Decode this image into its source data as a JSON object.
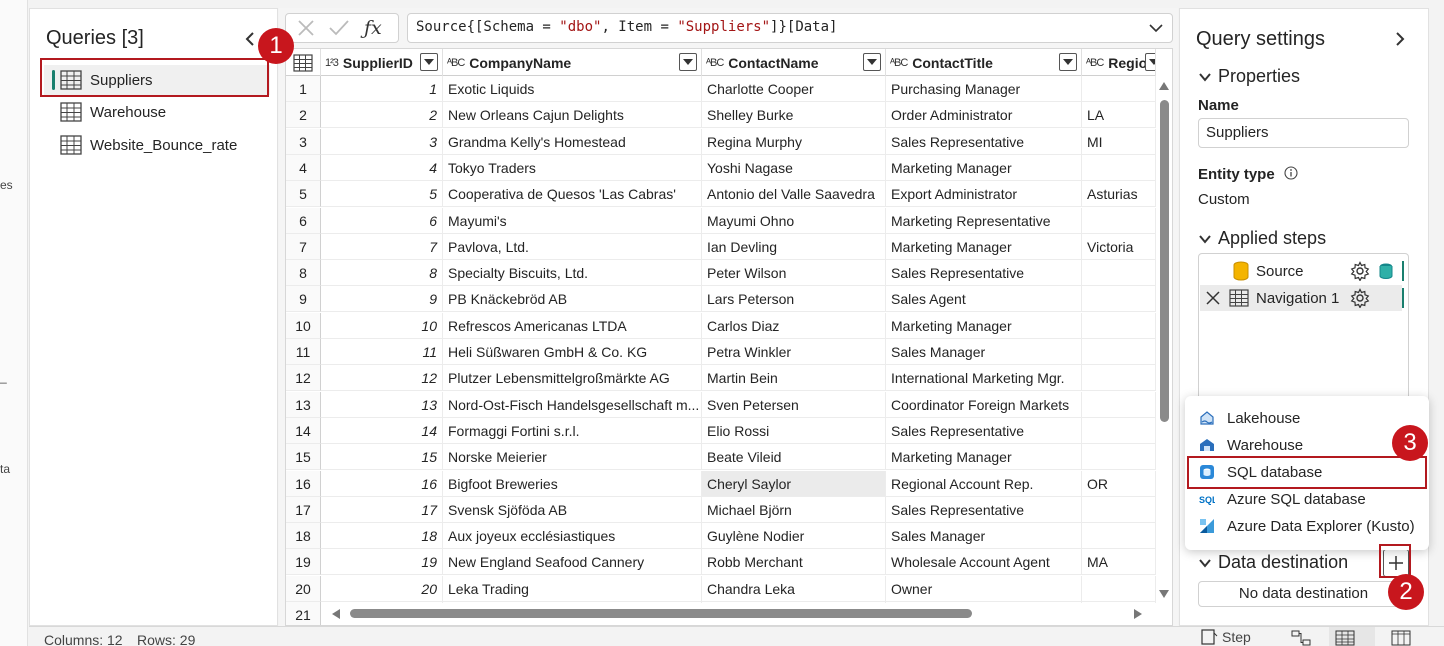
{
  "left_edge": {
    "fragments": [
      "es",
      "_",
      "ta"
    ]
  },
  "queries": {
    "title": "Queries [3]",
    "items": [
      {
        "label": "Suppliers"
      },
      {
        "label": "Warehouse"
      },
      {
        "label": "Website_Bounce_rate"
      }
    ]
  },
  "formula": {
    "prefix": "Source{[Schema = ",
    "str1": "\"dbo\"",
    "mid": ", Item = ",
    "str2": "\"Suppliers\"",
    "suffix": "]}[Data]"
  },
  "grid": {
    "type_icons": {
      "number": "1²3",
      "text": "ᴬBC"
    },
    "columns": [
      "SupplierID",
      "CompanyName",
      "ContactName",
      "ContactTitle",
      "Region"
    ],
    "rows": [
      [
        "1",
        "Exotic Liquids",
        "Charlotte Cooper",
        "Purchasing Manager",
        ""
      ],
      [
        "2",
        "New Orleans Cajun Delights",
        "Shelley Burke",
        "Order Administrator",
        "LA"
      ],
      [
        "3",
        "Grandma Kelly's Homestead",
        "Regina Murphy",
        "Sales Representative",
        "MI"
      ],
      [
        "4",
        "Tokyo Traders",
        "Yoshi Nagase",
        "Marketing Manager",
        ""
      ],
      [
        "5",
        "Cooperativa de Quesos 'Las Cabras'",
        "Antonio del Valle Saavedra",
        "Export Administrator",
        "Asturias"
      ],
      [
        "6",
        "Mayumi's",
        "Mayumi Ohno",
        "Marketing Representative",
        ""
      ],
      [
        "7",
        "Pavlova, Ltd.",
        "Ian Devling",
        "Marketing Manager",
        "Victoria"
      ],
      [
        "8",
        "Specialty Biscuits, Ltd.",
        "Peter Wilson",
        "Sales Representative",
        ""
      ],
      [
        "9",
        "PB Knäckebröd AB",
        "Lars Peterson",
        "Sales Agent",
        ""
      ],
      [
        "10",
        "Refrescos Americanas LTDA",
        "Carlos Diaz",
        "Marketing Manager",
        ""
      ],
      [
        "11",
        "Heli Süßwaren GmbH & Co. KG",
        "Petra Winkler",
        "Sales Manager",
        ""
      ],
      [
        "12",
        "Plutzer Lebensmittelgroßmärkte AG",
        "Martin Bein",
        "International Marketing Mgr.",
        ""
      ],
      [
        "13",
        "Nord-Ost-Fisch Handelsgesellschaft m...",
        "Sven Petersen",
        "Coordinator Foreign Markets",
        ""
      ],
      [
        "14",
        "Formaggi Fortini s.r.l.",
        "Elio Rossi",
        "Sales Representative",
        ""
      ],
      [
        "15",
        "Norske Meierier",
        "Beate Vileid",
        "Marketing Manager",
        ""
      ],
      [
        "16",
        "Bigfoot Breweries",
        "Cheryl Saylor",
        "Regional Account Rep.",
        "OR"
      ],
      [
        "17",
        "Svensk Sjöföda AB",
        "Michael Björn",
        "Sales Representative",
        ""
      ],
      [
        "18",
        "Aux joyeux ecclésiastiques",
        "Guylène Nodier",
        "Sales Manager",
        ""
      ],
      [
        "19",
        "New England Seafood Cannery",
        "Robb Merchant",
        "Wholesale Account Agent",
        "MA"
      ],
      [
        "20",
        "Leka Trading",
        "Chandra Leka",
        "Owner",
        ""
      ],
      [
        "21",
        "",
        "",
        "",
        ""
      ]
    ]
  },
  "settings": {
    "title": "Query settings",
    "properties_label": "Properties",
    "name_label": "Name",
    "name_value": "Suppliers",
    "entity_type_label": "Entity type",
    "entity_type_value": "Custom",
    "applied_steps_label": "Applied steps",
    "steps": [
      {
        "label": "Source"
      },
      {
        "label": "Navigation 1"
      }
    ],
    "data_destination_label": "Data destination",
    "no_destination": "No data destination"
  },
  "destination_menu": {
    "items": [
      {
        "label": "Lakehouse"
      },
      {
        "label": "Warehouse"
      },
      {
        "label": "SQL database"
      },
      {
        "label": "Azure SQL database"
      },
      {
        "label": "Azure Data Explorer (Kusto)"
      }
    ]
  },
  "callouts": {
    "one": "1",
    "two": "2",
    "three": "3"
  },
  "status": {
    "columns": "Columns: 12",
    "rows": "Rows: 29",
    "step": "Step"
  },
  "colors": {
    "accent_teal": "#1a7f6e",
    "callout_red": "#c8161d",
    "selected_row": "#ebebeb"
  }
}
